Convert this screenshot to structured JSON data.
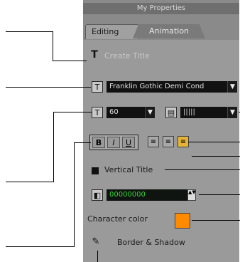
{
  "panel": {
    "title": "My Properties",
    "tabs": [
      {
        "label": "Editing"
      },
      {
        "label": "Animation"
      }
    ],
    "create_title_label": "Create Title",
    "font_name": "Franklin Gothic Demi Cond",
    "font_size": "60",
    "alignment_value": "|||||",
    "vertical_title_label": "Vertical Title",
    "color_value": "00000000",
    "character_color_label": "Character color",
    "character_color_value": "#ff8a00",
    "border_shadow_label": "Border & Shadow",
    "active_align_color": "#e3b436"
  },
  "glyphs": {
    "text_tool": "T",
    "font_icon": "T",
    "size_icon": "T",
    "align_icon": "▤",
    "bold": "B",
    "italic": "I",
    "underline": "U",
    "align_left": "≡",
    "align_center": "≡",
    "align_right": "≡",
    "dropdown": "▼",
    "spin": "▲▼",
    "color_icon": "◧",
    "border_icon": "✎"
  }
}
